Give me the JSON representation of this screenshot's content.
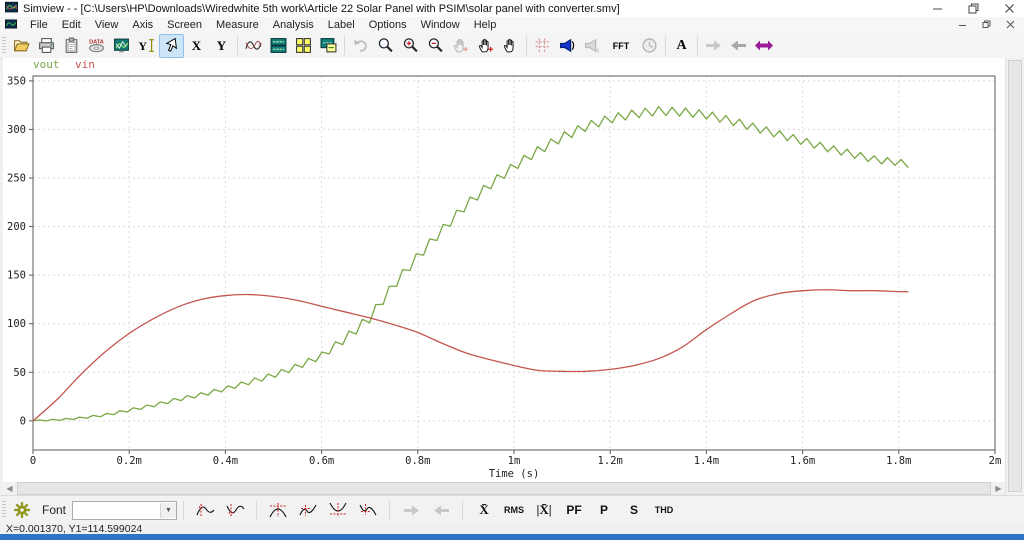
{
  "window": {
    "title": "Simview -  - [C:\\Users\\HP\\Downloads\\Wiredwhite 5th work\\Article 22 Solar Panel with PSIM\\solar panel with converter.smv]"
  },
  "menu": {
    "items": [
      "File",
      "Edit",
      "View",
      "Axis",
      "Screen",
      "Measure",
      "Analysis",
      "Label",
      "Options",
      "Window",
      "Help"
    ]
  },
  "toolbar": {
    "x_label": "X",
    "y_label": "Y",
    "fft_label": "FFT",
    "text_label": "A"
  },
  "bottom_toolbar": {
    "font_label": "Font",
    "mean_label": "X̄",
    "rms_label": "RMS",
    "absmean_label": "|X̄|",
    "pf_label": "PF",
    "p_label": "P",
    "s_label": "S",
    "thd_label": "THD"
  },
  "status_bar": {
    "text": "X=0.001370, Y1=114.599024"
  },
  "chart_data": {
    "type": "line",
    "xlabel": "Time (s)",
    "x_ticks": [
      "0",
      "0.2m",
      "0.4m",
      "0.6m",
      "0.8m",
      "1m",
      "1.2m",
      "1.4m",
      "1.6m",
      "1.8m",
      "2m"
    ],
    "x_tick_pos_ms": [
      0,
      0.2,
      0.4,
      0.6,
      0.8,
      1.0,
      1.2,
      1.4,
      1.6,
      1.8,
      2.0
    ],
    "y_ticks": [
      0,
      50,
      100,
      150,
      200,
      250,
      300,
      350
    ],
    "xlim_ms": [
      0,
      2
    ],
    "ylim": [
      -30,
      355
    ],
    "grid": true,
    "legend_position": "top-left",
    "colors": {
      "grid": "#dadada",
      "axis": "#5a5a5a",
      "tick_text": "#222222"
    },
    "series": [
      {
        "name": "vout",
        "color": "#79a844",
        "style": "staircase-ripple",
        "ripple": {
          "period_ms": 0.028,
          "up_phase": 0.45,
          "amp_points": [
            [
              0,
              0.5
            ],
            [
              0.2,
              1.5
            ],
            [
              0.45,
              2.5
            ],
            [
              0.6,
              3.5
            ],
            [
              0.68,
              5
            ],
            [
              1.3,
              4.5
            ],
            [
              1.82,
              3.5
            ]
          ]
        },
        "points": [
          [
            0,
            0
          ],
          [
            0.05,
            1
          ],
          [
            0.1,
            3
          ],
          [
            0.15,
            6
          ],
          [
            0.2,
            11
          ],
          [
            0.25,
            16
          ],
          [
            0.3,
            22
          ],
          [
            0.35,
            27
          ],
          [
            0.4,
            33
          ],
          [
            0.45,
            40
          ],
          [
            0.5,
            47
          ],
          [
            0.55,
            56
          ],
          [
            0.6,
            67
          ],
          [
            0.65,
            85
          ],
          [
            0.7,
            106
          ],
          [
            0.75,
            140
          ],
          [
            0.8,
            169
          ],
          [
            0.85,
            196
          ],
          [
            0.9,
            222
          ],
          [
            0.95,
            243
          ],
          [
            1.0,
            262
          ],
          [
            1.05,
            278
          ],
          [
            1.1,
            292
          ],
          [
            1.15,
            303
          ],
          [
            1.2,
            311
          ],
          [
            1.25,
            316
          ],
          [
            1.3,
            319
          ],
          [
            1.35,
            318
          ],
          [
            1.4,
            315
          ],
          [
            1.45,
            309
          ],
          [
            1.5,
            302
          ],
          [
            1.55,
            295
          ],
          [
            1.6,
            288
          ],
          [
            1.65,
            281
          ],
          [
            1.7,
            275
          ],
          [
            1.75,
            269
          ],
          [
            1.8,
            266
          ],
          [
            1.82,
            264
          ]
        ]
      },
      {
        "name": "vin",
        "color": "#c4554f",
        "style": "smooth",
        "points": [
          [
            0,
            0
          ],
          [
            0.05,
            22
          ],
          [
            0.1,
            48
          ],
          [
            0.15,
            71
          ],
          [
            0.2,
            90
          ],
          [
            0.25,
            105
          ],
          [
            0.3,
            117
          ],
          [
            0.35,
            125
          ],
          [
            0.4,
            129
          ],
          [
            0.45,
            130
          ],
          [
            0.5,
            128
          ],
          [
            0.55,
            124
          ],
          [
            0.6,
            118
          ],
          [
            0.65,
            112
          ],
          [
            0.7,
            106
          ],
          [
            0.75,
            99
          ],
          [
            0.8,
            91
          ],
          [
            0.85,
            80
          ],
          [
            0.9,
            70
          ],
          [
            0.95,
            63
          ],
          [
            1.0,
            57
          ],
          [
            1.05,
            52
          ],
          [
            1.1,
            51
          ],
          [
            1.15,
            51
          ],
          [
            1.2,
            53
          ],
          [
            1.25,
            57
          ],
          [
            1.3,
            64
          ],
          [
            1.35,
            76
          ],
          [
            1.4,
            94
          ],
          [
            1.45,
            110
          ],
          [
            1.5,
            124
          ],
          [
            1.55,
            131
          ],
          [
            1.6,
            134
          ],
          [
            1.65,
            135
          ],
          [
            1.7,
            134
          ],
          [
            1.75,
            134
          ],
          [
            1.8,
            133
          ],
          [
            1.82,
            133
          ]
        ]
      }
    ]
  }
}
